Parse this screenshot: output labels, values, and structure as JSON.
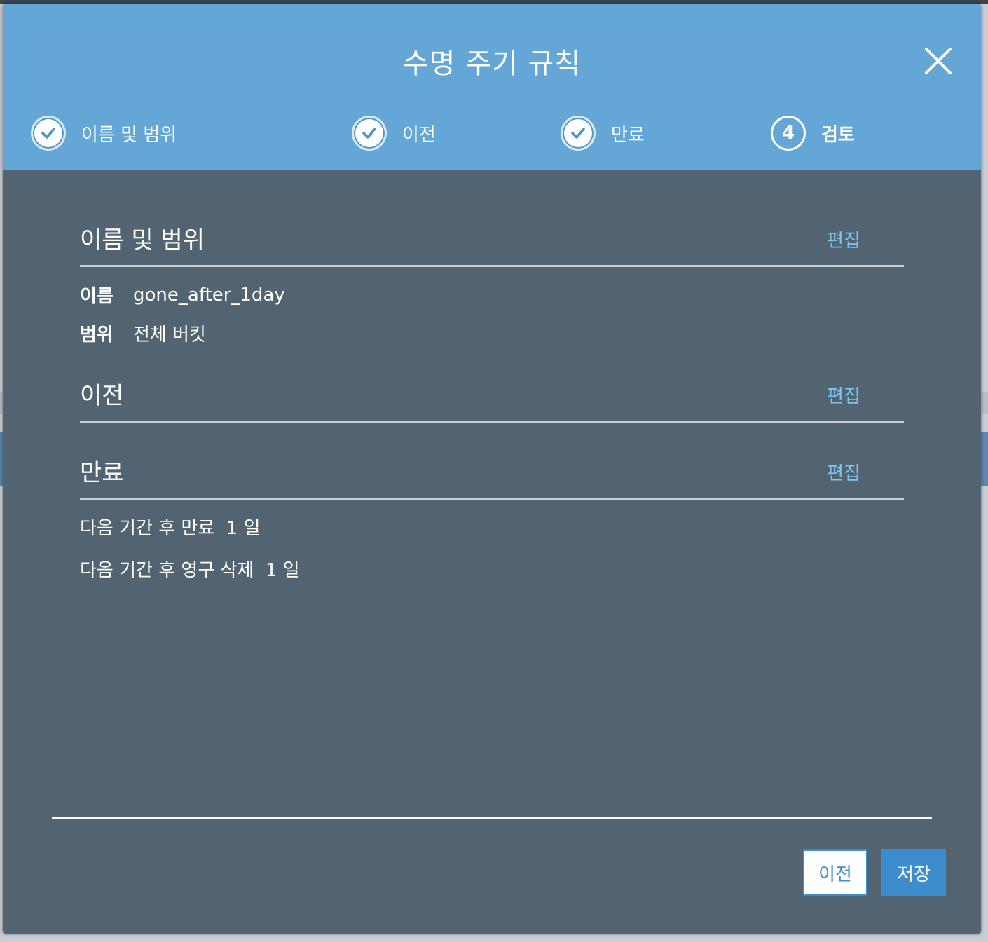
{
  "modal": {
    "title": "수명 주기 규칙"
  },
  "steps": [
    {
      "label": "이름 및 범위",
      "state": "done",
      "icon": "check-icon"
    },
    {
      "label": "이전",
      "state": "done",
      "icon": "check-icon"
    },
    {
      "label": "만료",
      "state": "done",
      "icon": "check-icon"
    },
    {
      "label": "검토",
      "state": "active",
      "number": "4"
    }
  ],
  "sections": {
    "name_scope": {
      "title": "이름 및 범위",
      "edit": "편집",
      "name_key": "이름",
      "name_value": "gone_after_1day",
      "scope_key": "범위",
      "scope_value": "전체 버킷"
    },
    "transition": {
      "title": "이전",
      "edit": "편집"
    },
    "expiration": {
      "title": "만료",
      "edit": "편집",
      "line1": "다음 기간 후 만료  1 일",
      "line2": "다음 기간 후 영구 삭제  1 일"
    }
  },
  "footer": {
    "prev_label": "이전",
    "save_label": "저장"
  },
  "colors": {
    "header_bg": "#64a6d6",
    "body_bg": "#526372",
    "edit_link": "#7fc6ee",
    "primary_button": "#3d8ccc"
  }
}
